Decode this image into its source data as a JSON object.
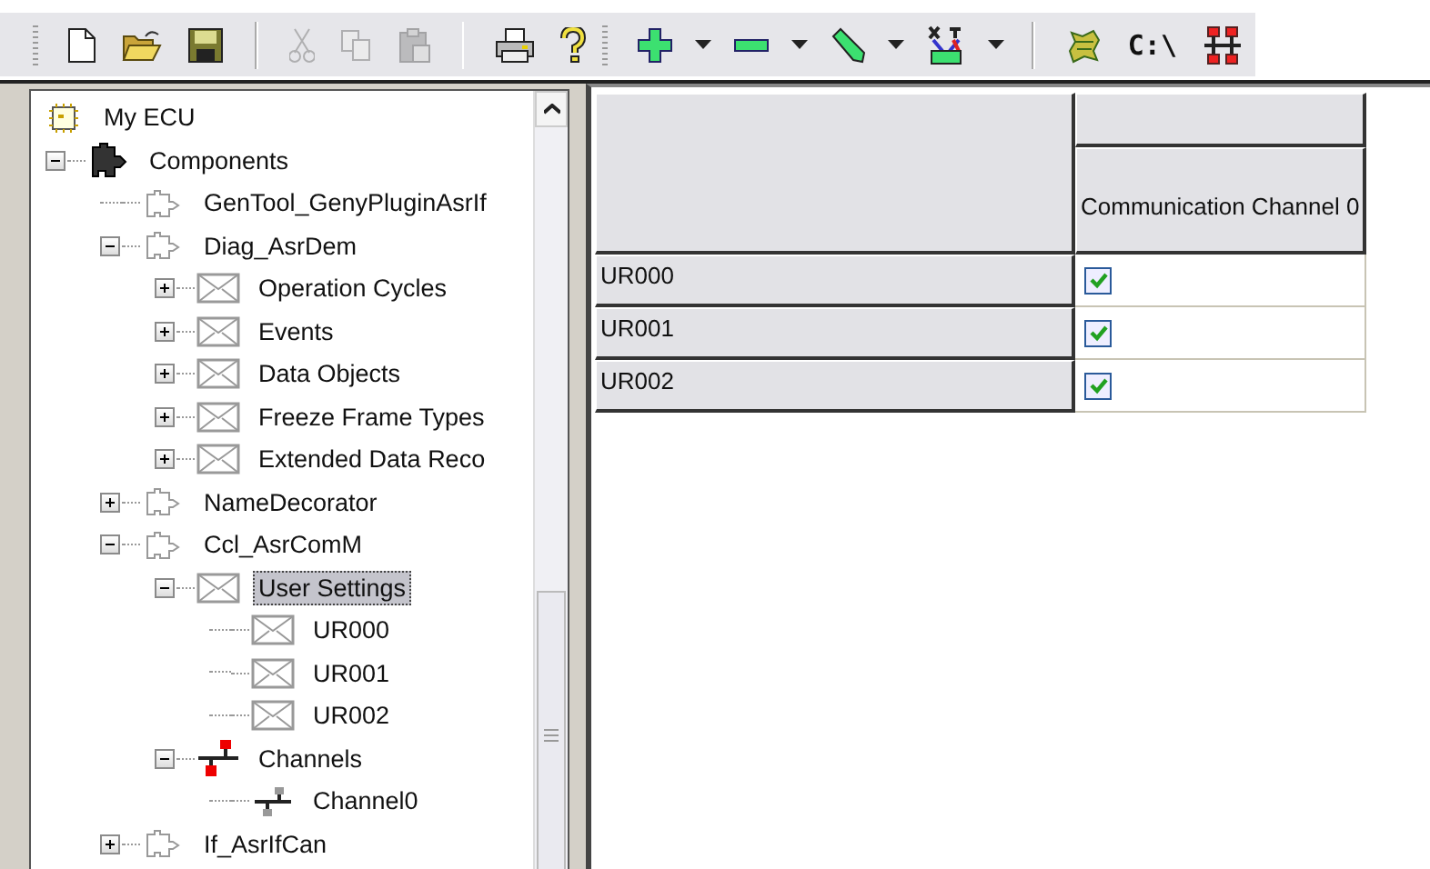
{
  "toolbar": {
    "groups": [
      {
        "gripper": true,
        "items": [
          {
            "kind": "new",
            "disabled": false
          },
          {
            "kind": "open",
            "disabled": false
          },
          {
            "kind": "save",
            "disabled": false
          }
        ]
      },
      {
        "items": [
          {
            "kind": "cut",
            "disabled": true
          },
          {
            "kind": "copy",
            "disabled": true
          },
          {
            "kind": "paste",
            "disabled": true
          }
        ]
      },
      {
        "items": [
          {
            "kind": "print",
            "disabled": false
          },
          {
            "kind": "help",
            "disabled": false
          }
        ]
      },
      {
        "gripper": true,
        "items": [
          {
            "kind": "add",
            "dropdown": true,
            "disabled": false
          },
          {
            "kind": "remove",
            "dropdown": true,
            "disabled": false
          },
          {
            "kind": "edit",
            "dropdown": true,
            "disabled": false
          },
          {
            "kind": "map",
            "dropdown": true,
            "disabled": false
          }
        ]
      },
      {
        "items": [
          {
            "kind": "generate",
            "disabled": false
          },
          {
            "kind": "text",
            "label": "C:\\",
            "disabled": false
          },
          {
            "kind": "network",
            "disabled": false
          }
        ]
      }
    ]
  },
  "tree": [
    {
      "label": "My ECU",
      "kind": "ecu",
      "selected": false,
      "children": [
        {
          "label": "Components",
          "kind": "components",
          "expanded": true,
          "selected": false,
          "children": [
            {
              "label": "GenTool_GenyPluginAsrIf",
              "kind": "module",
              "selected": false
            },
            {
              "label": "Diag_AsrDem",
              "kind": "module",
              "expanded": true,
              "selected": false,
              "children": [
                {
                  "label": "Operation Cycles",
                  "kind": "folder",
                  "expanded": false,
                  "selected": false
                },
                {
                  "label": "Events",
                  "kind": "folder",
                  "expanded": false,
                  "selected": false
                },
                {
                  "label": "Data Objects",
                  "kind": "folder",
                  "expanded": false,
                  "selected": false
                },
                {
                  "label": "Freeze Frame Types",
                  "kind": "folder",
                  "expanded": false,
                  "selected": false
                },
                {
                  "label": "Extended Data Reco",
                  "kind": "folder",
                  "expanded": false,
                  "selected": false
                }
              ]
            },
            {
              "label": "NameDecorator",
              "kind": "module",
              "expanded": false,
              "selected": false
            },
            {
              "label": "Ccl_AsrComM",
              "kind": "module",
              "expanded": true,
              "selected": false,
              "children": [
                {
                  "label": "User Settings",
                  "kind": "folder",
                  "expanded": true,
                  "selected": true,
                  "children": [
                    {
                      "label": "UR000",
                      "kind": "folder",
                      "selected": false
                    },
                    {
                      "label": "UR001",
                      "kind": "folder",
                      "selected": false
                    },
                    {
                      "label": "UR002",
                      "kind": "folder",
                      "selected": false
                    }
                  ]
                },
                {
                  "label": "Channels",
                  "kind": "channels",
                  "expanded": true,
                  "selected": false,
                  "children": [
                    {
                      "label": "Channel0",
                      "kind": "channel",
                      "selected": false
                    }
                  ]
                }
              ]
            },
            {
              "label": "If_AsrIfCan",
              "kind": "module",
              "expanded": false,
              "selected": false
            }
          ]
        }
      ]
    }
  ],
  "grid": {
    "columns": [
      "Communication Channel 0"
    ],
    "rows": [
      {
        "label": "UR000",
        "values": [
          true
        ]
      },
      {
        "label": "UR001",
        "values": [
          true
        ]
      },
      {
        "label": "UR002",
        "values": [
          true
        ]
      }
    ]
  }
}
